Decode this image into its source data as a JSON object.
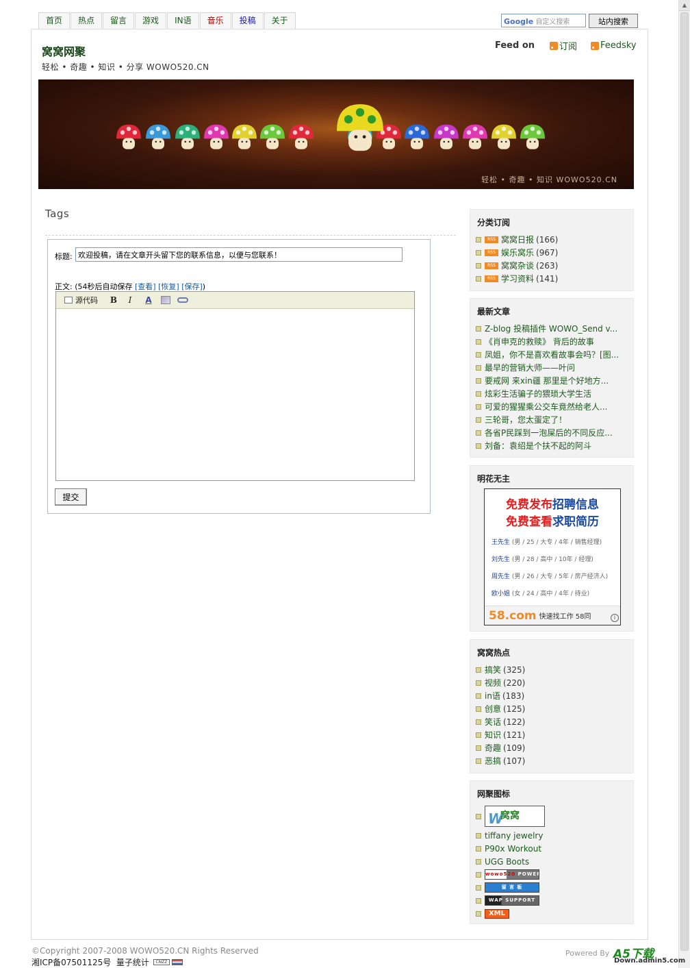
{
  "nav": {
    "items": [
      {
        "label": "首页",
        "color": "#1a5a1a"
      },
      {
        "label": "热点",
        "color": "#1a5a1a"
      },
      {
        "label": "留言",
        "color": "#1a5a1a"
      },
      {
        "label": "游戏",
        "color": "#1a5a1a"
      },
      {
        "label": "IN语",
        "color": "#1a5a1a"
      },
      {
        "label": "音乐",
        "color": "#b00000"
      },
      {
        "label": "投稿",
        "color": "#1a1a9a"
      },
      {
        "label": "关于",
        "color": "#1a5a1a"
      }
    ]
  },
  "search": {
    "brand": "Google",
    "placeholder": "自定义搜索",
    "button": "站内搜索"
  },
  "header": {
    "title": "窝窝网聚",
    "subtitle": "轻松 • 奇趣 • 知识 • 分享 WOWO520.CN"
  },
  "feed": {
    "label": "Feed on",
    "subscribe": "订阅",
    "feedsky": "Feedsky"
  },
  "banner": {
    "text": "轻松 • 奇趣 • 知识 WOWO520.CN"
  },
  "main": {
    "heading": "Tags",
    "title_label": "标题:",
    "title_value": "欢迎投稿，请在文章开头留下您的联系信息，以便与您联系！",
    "body_label": "正文: (54秒后自动保存",
    "body_view": "[查看]",
    "body_restore": "[恢复]",
    "body_save": "[保存]",
    "body_close": ")",
    "toolbar": {
      "source": "源代码",
      "bold": "B",
      "italic": "I",
      "color": "A"
    },
    "submit": "提交"
  },
  "sidebar": {
    "categories": {
      "title": "分类订阅",
      "items": [
        {
          "label": "窝窝日报",
          "count": "(166)"
        },
        {
          "label": "娱乐窝乐",
          "count": "(967)"
        },
        {
          "label": "窝窝杂谈",
          "count": "(263)"
        },
        {
          "label": "学习资料",
          "count": "(141)"
        }
      ]
    },
    "latest": {
      "title": "最新文章",
      "items": [
        "Z-blog 投稿插件 WOWO_Send v...",
        "《肖申克的救赎》 背后的故事",
        "凤姐，你不是喜欢看故事会吗？[图...",
        "最早的营销大师——叶问",
        "要戒网 来xin疆 那里是个好地方...",
        "炫彩生活骗子的猥琐大学生活",
        "可爱的猩猩乘公交车竟然给老人...",
        "三轮哥，您太蛋定了！",
        "各省P民踩到一泡屎后的不同反应...",
        "刘备：袁绍是个扶不起的阿斗"
      ]
    },
    "ad": {
      "title": "明花无主",
      "line1_a": "免费发布",
      "line1_b": "招聘信息",
      "line2_a": "免费查看",
      "line2_b": "求职简历",
      "rows": [
        {
          "name": "王先生",
          "info": "(男 / 25 / 大专 / 4年 / 销售经理)"
        },
        {
          "name": "刘先生",
          "info": "(男 / 28 / 高中 / 10年 / 经理)"
        },
        {
          "name": "周先生",
          "info": "(男 / 26 / 大专 / 5年 / 房产经济人)"
        },
        {
          "name": "欧小姐",
          "info": "(女 / 24 / 高中 / 4年 / 待业)"
        }
      ],
      "brand": "58.com",
      "brand_text": "快速找工作 58同"
    },
    "hot": {
      "title": "窝窝热点",
      "items": [
        {
          "label": "搞笑",
          "count": "(325)"
        },
        {
          "label": "视频",
          "count": "(220)"
        },
        {
          "label": "in语",
          "count": "(183)"
        },
        {
          "label": "创意",
          "count": "(125)"
        },
        {
          "label": "笑话",
          "count": "(122)"
        },
        {
          "label": "知识",
          "count": "(121)"
        },
        {
          "label": "奇趣",
          "count": "(109)"
        },
        {
          "label": "恶搞",
          "count": "(107)"
        }
      ]
    },
    "links": {
      "title": "网聚图标",
      "logo_text": "窝窝",
      "logo_letter": "W",
      "text_links": [
        "tiffany jewelry",
        "P90x Workout",
        "UGG Boots"
      ],
      "badge_wowo_a": "wowo520",
      "badge_wowo_b": "POWERED",
      "badge_msg": "留 言 板",
      "badge_wap": "WAP SUPPORT",
      "badge_xml": "XML"
    }
  },
  "footer": {
    "copyright": "©Copyright 2007-2008 WOWO520.CN Rights Reserved",
    "icp": "湘ICP备07501125号",
    "stats": "量子统计",
    "cnzz": "CNZZ",
    "powered": "Powered By",
    "a5": "A5下载",
    "a5sub": "Down.admin5.com"
  }
}
